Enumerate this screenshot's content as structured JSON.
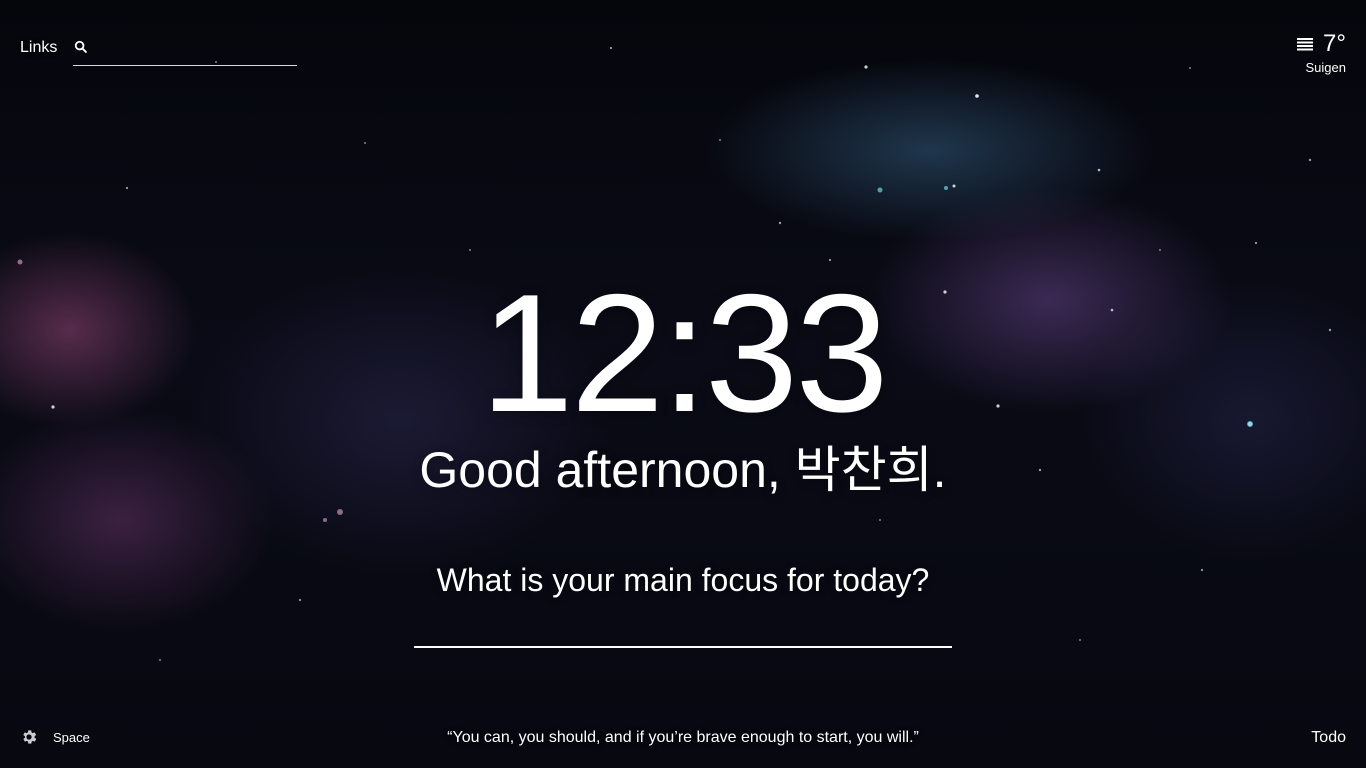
{
  "background": {
    "theme": "space nebula",
    "colors": [
      "#05060c",
      "#963c78",
      "#785aa0",
      "#3c6e96"
    ]
  },
  "header": {
    "links_label": "Links",
    "search": {
      "icon": "search-icon",
      "placeholder": "",
      "value": ""
    }
  },
  "weather": {
    "icon": "weather-lines-icon",
    "temperature": "7°",
    "location": "Suigen"
  },
  "main": {
    "time": "12:33",
    "greeting": "Good afternoon, 박찬희.",
    "focus_question": "What is your main focus for today?",
    "focus_value": ""
  },
  "footer": {
    "settings_icon": "gear-icon",
    "space_label": "Space",
    "quote": "“You can, you should, and if you’re brave enough to start, you will.”",
    "todo_label": "Todo"
  }
}
